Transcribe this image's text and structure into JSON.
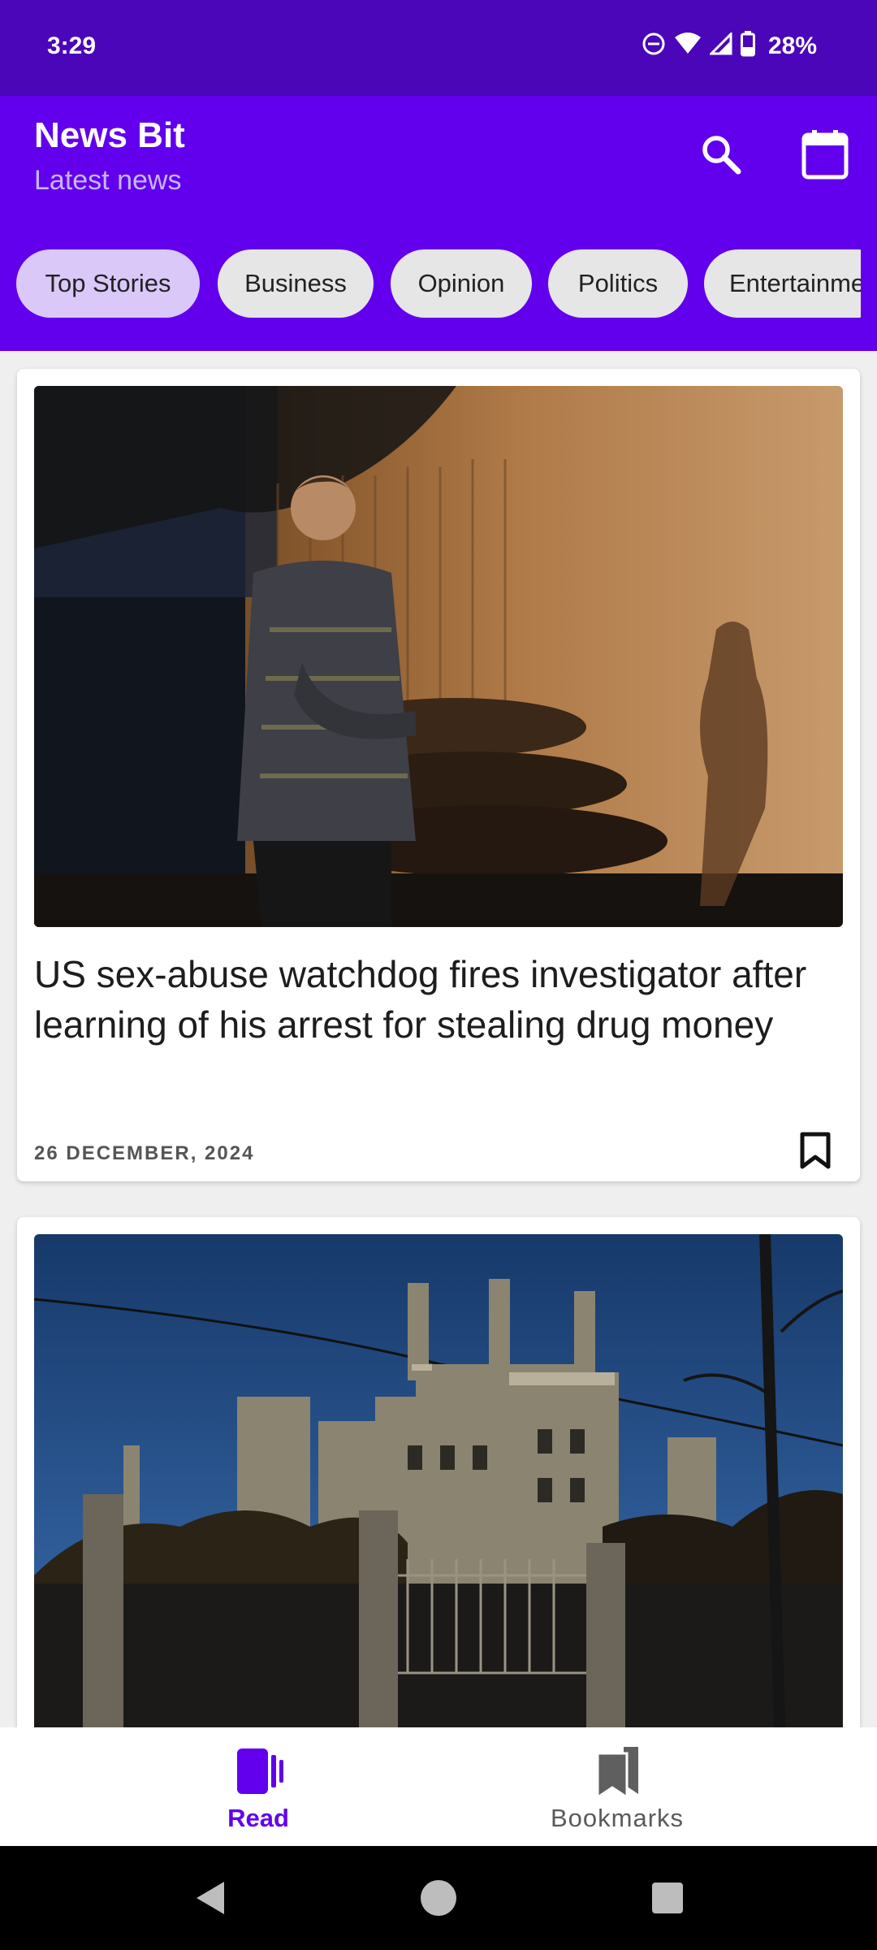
{
  "status_bar": {
    "time": "3:29",
    "battery_percent": "28%",
    "icons": [
      "do-not-disturb-icon",
      "wifi-icon",
      "signal-icon",
      "battery-icon"
    ]
  },
  "app_bar": {
    "title": "News Bit",
    "subtitle": "Latest news",
    "actions": [
      "search-icon",
      "calendar-icon"
    ]
  },
  "categories": {
    "items": [
      "Top Stories",
      "Business",
      "Opinion",
      "Politics",
      "Entertainment"
    ],
    "selected": "Top Stories"
  },
  "articles": [
    {
      "title": "US sex-abuse watchdog fires investigator after learning of his arrest for stealing drug money",
      "date": "26 DECEMBER, 2024",
      "image": "photo of a man with crossed arms standing beside a sunlit wall",
      "bookmark_icon": "bookmark-outline-icon"
    },
    {
      "title": "",
      "date": "",
      "image": "photo of a stone castle with towers under a blue sky behind a fence",
      "bookmark_icon": "bookmark-outline-icon"
    }
  ],
  "bottom_nav": {
    "items": [
      {
        "label": "Read",
        "icon": "read-icon",
        "active": true
      },
      {
        "label": "Bookmarks",
        "icon": "bookmarks-icon",
        "active": false
      }
    ]
  },
  "colors": {
    "status_bar": "#4a06b8",
    "primary": "#6200ee",
    "selected_chip": "#d9c8f8",
    "chip": "#e6e6e6"
  }
}
